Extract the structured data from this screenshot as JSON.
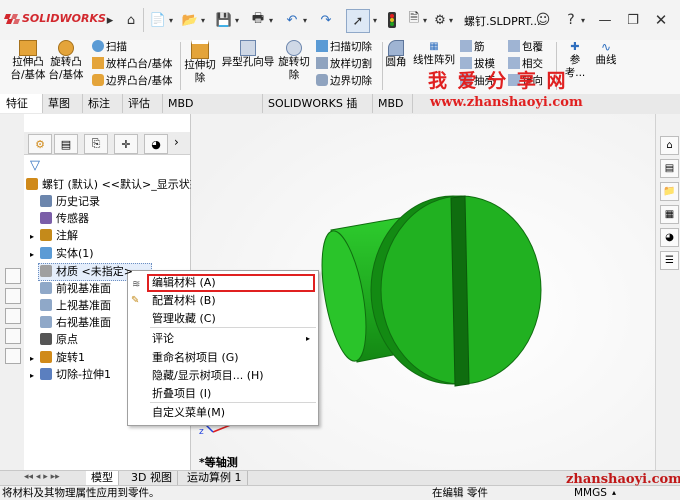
{
  "app": {
    "logo_text": "SOLIDWORKS",
    "doc_title": "螺钉.SLDPRT...",
    "brand_color": "#d2282e"
  },
  "ribbon": {
    "extrude_boss": "拉伸凸\n台/基体",
    "revolve_boss": "旋转凸\n台/基体",
    "sweep": "扫描",
    "loft_boss": "放样凸台/基体",
    "boundary_boss": "边界凸台/基体",
    "extrude_cut": "拉伸切\n除",
    "hole_wizard": "异型孔向导",
    "revolve_cut": "旋转切\n除",
    "sweep_cut": "扫描切除",
    "loft_cut": "放样切割",
    "boundary_cut": "边界切除",
    "fillet": "圆角",
    "linear_pattern": "线性阵列",
    "rib": "筋",
    "draft": "拔模",
    "shell": "抽壳",
    "wrap": "包覆",
    "intersect": "相交",
    "mirror": "镜向",
    "reference": "参考...",
    "curves": "曲线"
  },
  "watermark": {
    "title": "我 爱 分 享 网",
    "url": "www.zhanshaoyi.com",
    "footer_url": "zhanshaoyi.com"
  },
  "tabs": [
    "特征",
    "草图",
    "标注",
    "评估",
    "MBD Dimensions",
    "SOLIDWORKS 插件",
    "MBD"
  ],
  "tree": {
    "root": "螺钉 (默认) <<默认>_显示状态",
    "items": [
      {
        "label": "历史记录",
        "icon": "history-icon",
        "expand": false
      },
      {
        "label": "传感器",
        "icon": "sensor-icon",
        "expand": false
      },
      {
        "label": "注解",
        "icon": "annotation-icon",
        "expand": true
      },
      {
        "label": "实体(1)",
        "icon": "solid-body-icon",
        "expand": true
      },
      {
        "label": "材质 <未指定>",
        "icon": "material-icon",
        "expand": false
      },
      {
        "label": "前视基准面",
        "icon": "plane-icon",
        "expand": false
      },
      {
        "label": "上视基准面",
        "icon": "plane-icon",
        "expand": false
      },
      {
        "label": "右视基准面",
        "icon": "plane-icon",
        "expand": false
      },
      {
        "label": "原点",
        "icon": "origin-icon",
        "expand": false
      },
      {
        "label": "旋转1",
        "icon": "revolve-icon",
        "expand": true
      },
      {
        "label": "切除-拉伸1",
        "icon": "cut-extrude-icon",
        "expand": true
      }
    ]
  },
  "context_menu": {
    "items": [
      {
        "label": "编辑材料 (A)",
        "highlight": true
      },
      {
        "label": "配置材料 (B)"
      },
      {
        "label": "管理收藏 (C)"
      },
      {
        "label": "评论",
        "submenu": true
      },
      {
        "label": "重命名树项目 (G)"
      },
      {
        "label": "隐藏/显示树项目... (H)"
      },
      {
        "label": "折叠项目 (I)"
      },
      {
        "label": "自定义菜单(M)"
      }
    ]
  },
  "viewport": {
    "view_label": "*等轴测",
    "part_color": "#1fae1f"
  },
  "bottom_tabs": [
    "模型",
    "3D 视图",
    "运动算例 1"
  ],
  "status": {
    "message": "将材料及其物理属性应用到零件。",
    "editing": "在编辑 零件",
    "units": "MMGS"
  }
}
